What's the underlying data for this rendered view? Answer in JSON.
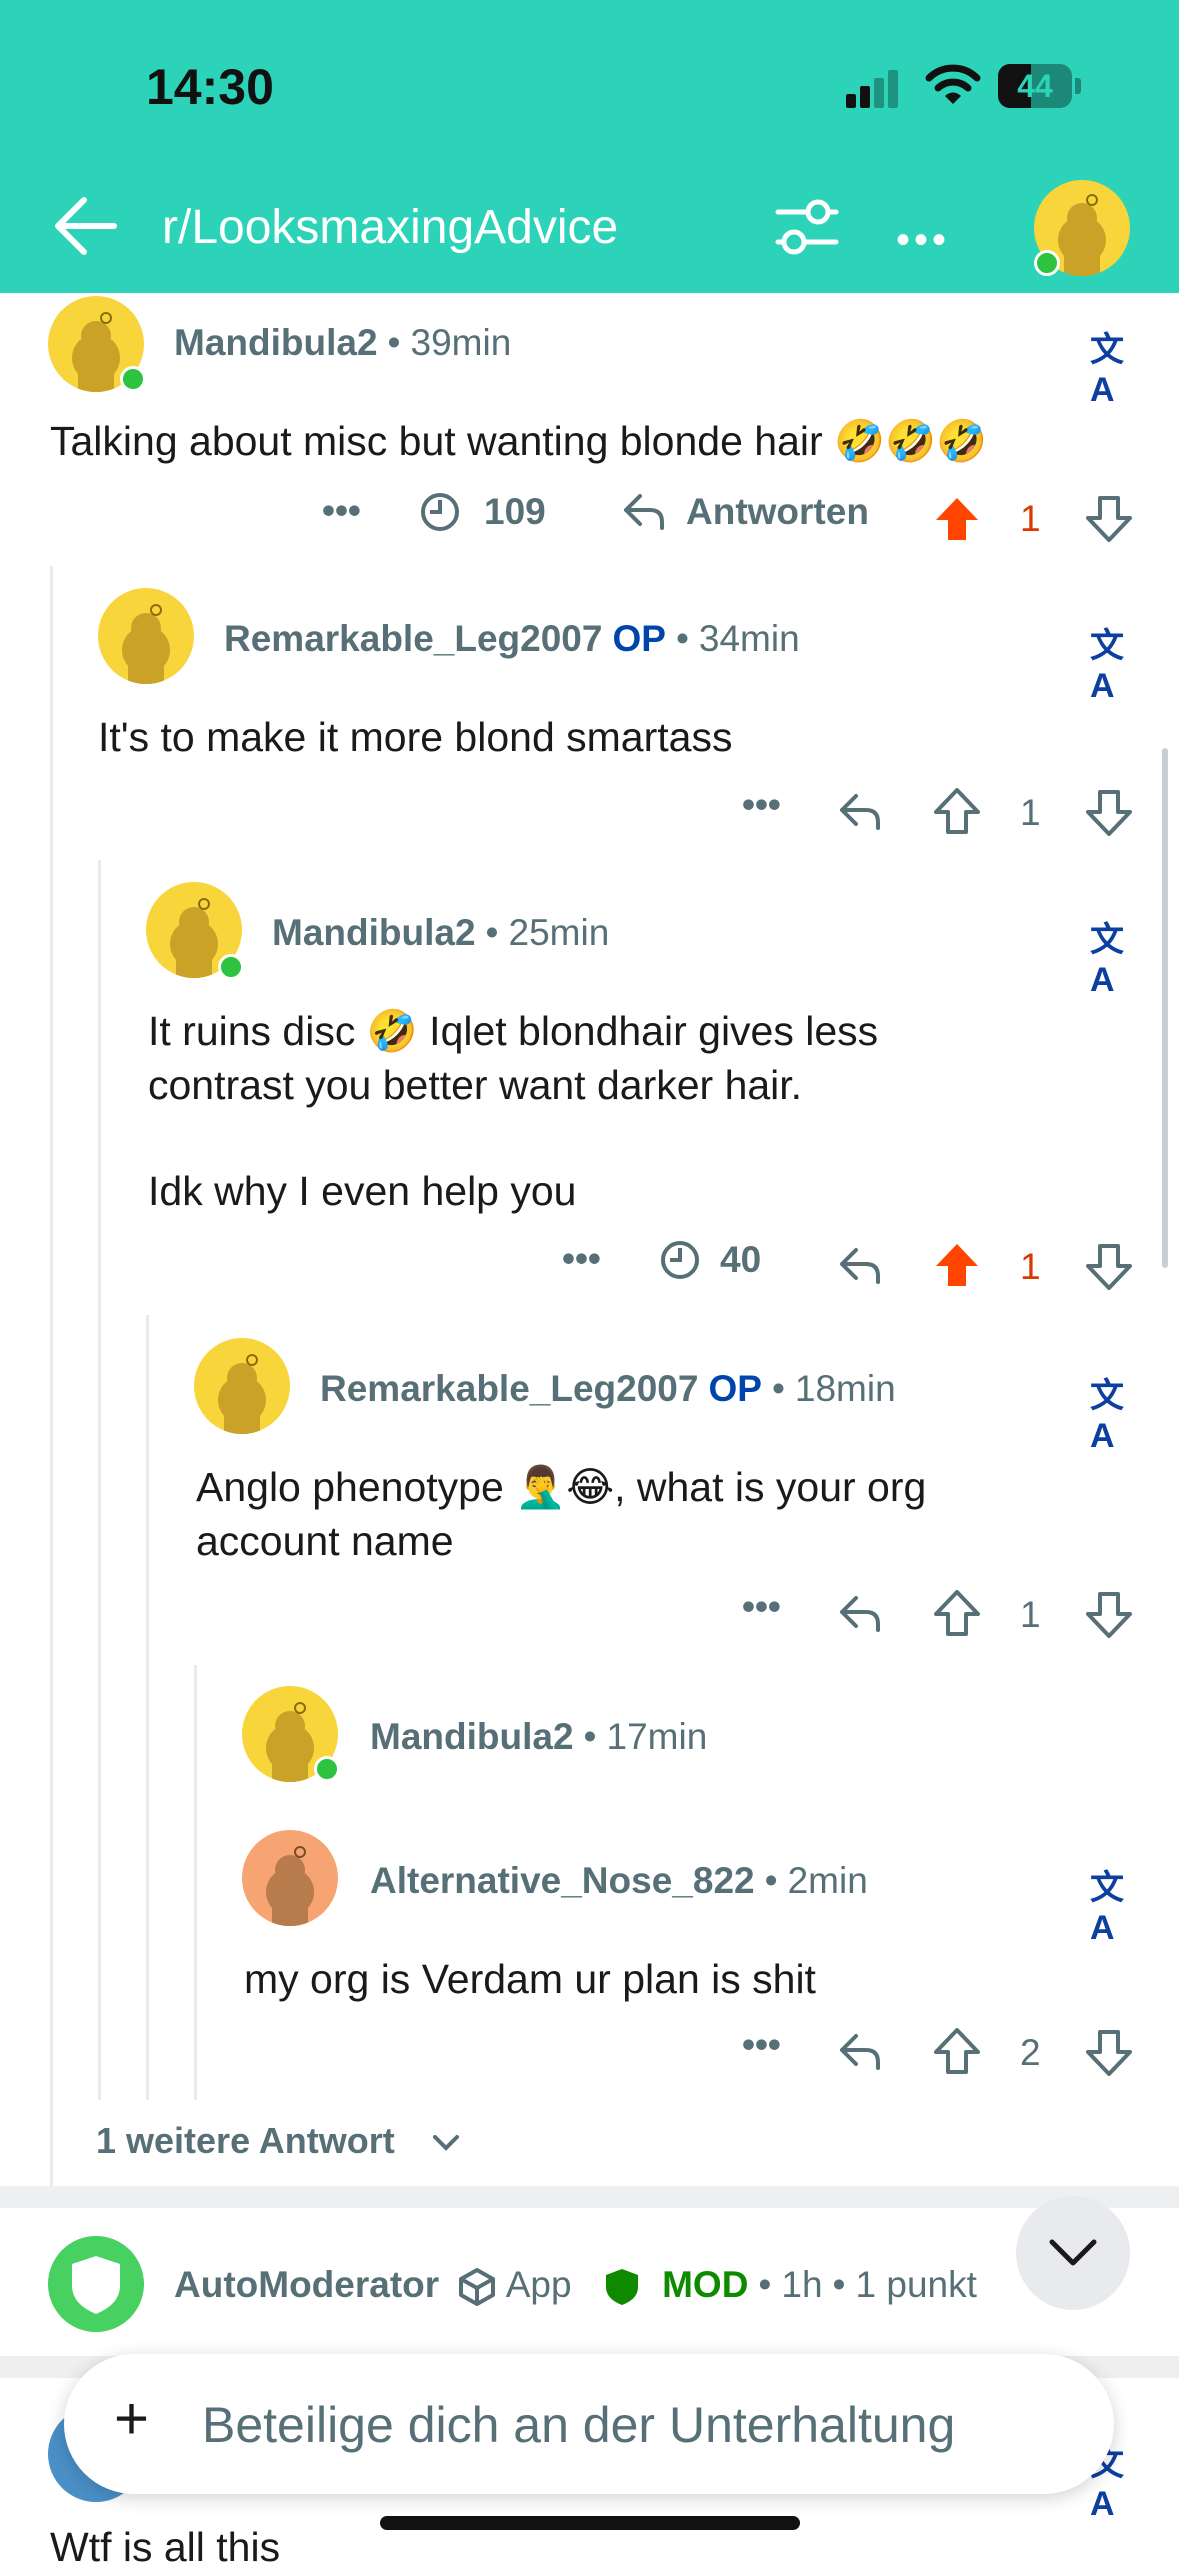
{
  "status_bar": {
    "time": "14:30",
    "battery": "44",
    "battery_level": 0.44
  },
  "header": {
    "subreddit": "r/LooksmaxingAdvice"
  },
  "comments": [
    {
      "user": "Mandibula2",
      "time": "39min",
      "text": "Talking about misc but wanting blonde hair 🤣🤣🤣",
      "award_count": "109",
      "reply_label": "Antworten",
      "votes": "1"
    },
    {
      "user": "Remarkable_Leg2007",
      "op": "OP",
      "time": "34min",
      "text": "It's to make it more blond smartass",
      "votes": "1"
    },
    {
      "user": "Mandibula2",
      "time": "25min",
      "text_line1": "It ruins disc 🤣 Iqlet blondhair gives less",
      "text_line2": "contrast you better want darker hair.",
      "text_line3": "Idk why I even help you",
      "award_count": "40",
      "votes": "1"
    },
    {
      "user": "Remarkable_Leg2007",
      "op": "OP",
      "time": "18min",
      "text_line1": "Anglo phenotype 🤦‍♂️😂, what is your org",
      "text_line2": "account name",
      "votes": "1"
    },
    {
      "user": "Mandibula2",
      "time": "17min"
    },
    {
      "user": "Alternative_Nose_822",
      "time": "2min",
      "text": "my org is Verdam ur plan is shit",
      "votes": "2"
    }
  ],
  "more_replies": "1 weitere Antwort",
  "automod": {
    "user": "AutoModerator",
    "app": "App",
    "mod": "MOD",
    "time": "1h",
    "points": "1 punkt"
  },
  "next_comment_text": "Wtf is all this",
  "composer": {
    "placeholder": "Beteilige dich an der Unterhaltung"
  },
  "colors": {
    "header_bg": "#2cd3b8",
    "upvote_active": "#ff4500",
    "op_blue": "#0045ac",
    "mod_green": "#0e8a00"
  },
  "separator": "•",
  "translate_glyph": "文A",
  "more_glyph": "•••"
}
